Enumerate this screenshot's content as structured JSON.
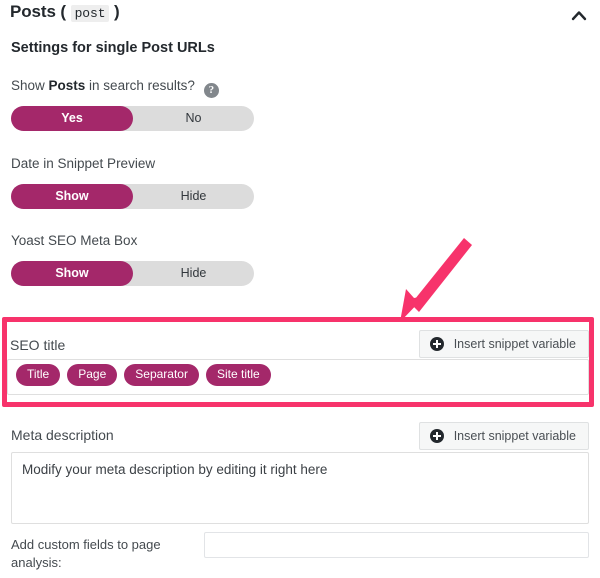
{
  "header": {
    "title": "Posts",
    "open_paren": "(",
    "post_type_slug": "post",
    "close_paren": ")",
    "collapse_icon": "chevron-up-icon"
  },
  "subtitle": "Settings for single Post URLs",
  "fields": [
    {
      "label_prefix": "Show ",
      "label_strong": "Posts",
      "label_suffix": " in search results?",
      "help_icon": "help-circle-icon",
      "toggle": {
        "left_option": "Yes",
        "right_option": "No",
        "selected": "Yes"
      }
    },
    {
      "label": "Date in Snippet Preview",
      "toggle": {
        "left_option": "Show",
        "right_option": "Hide",
        "selected": "Show"
      }
    },
    {
      "label": "Yoast SEO Meta Box",
      "toggle": {
        "left_option": "Show",
        "right_option": "Hide",
        "selected": "Show"
      }
    }
  ],
  "seo_title": {
    "label": "SEO title",
    "snippet_button": {
      "label": "Insert snippet variable",
      "icon": "plus-circle-icon"
    },
    "chips": [
      "Title",
      "Page",
      "Separator",
      "Site title"
    ]
  },
  "meta_description": {
    "label": "Meta description",
    "snippet_button": {
      "label": "Insert snippet variable",
      "icon": "plus-circle-icon"
    },
    "value": "Modify your meta description by editing it right here",
    "placeholder": "Modify your meta description by editing it right here"
  },
  "custom_fields": {
    "label": "Add custom fields to page analysis:",
    "value": "",
    "placeholder": ""
  },
  "annotation": {
    "arrow_icon": "annotation-arrow-icon",
    "highlight_color": "#f7336b"
  },
  "colors": {
    "accent_magenta": "#a4286a",
    "annotation_pink": "#f7336b",
    "toggle_track": "#dcdcdc"
  }
}
